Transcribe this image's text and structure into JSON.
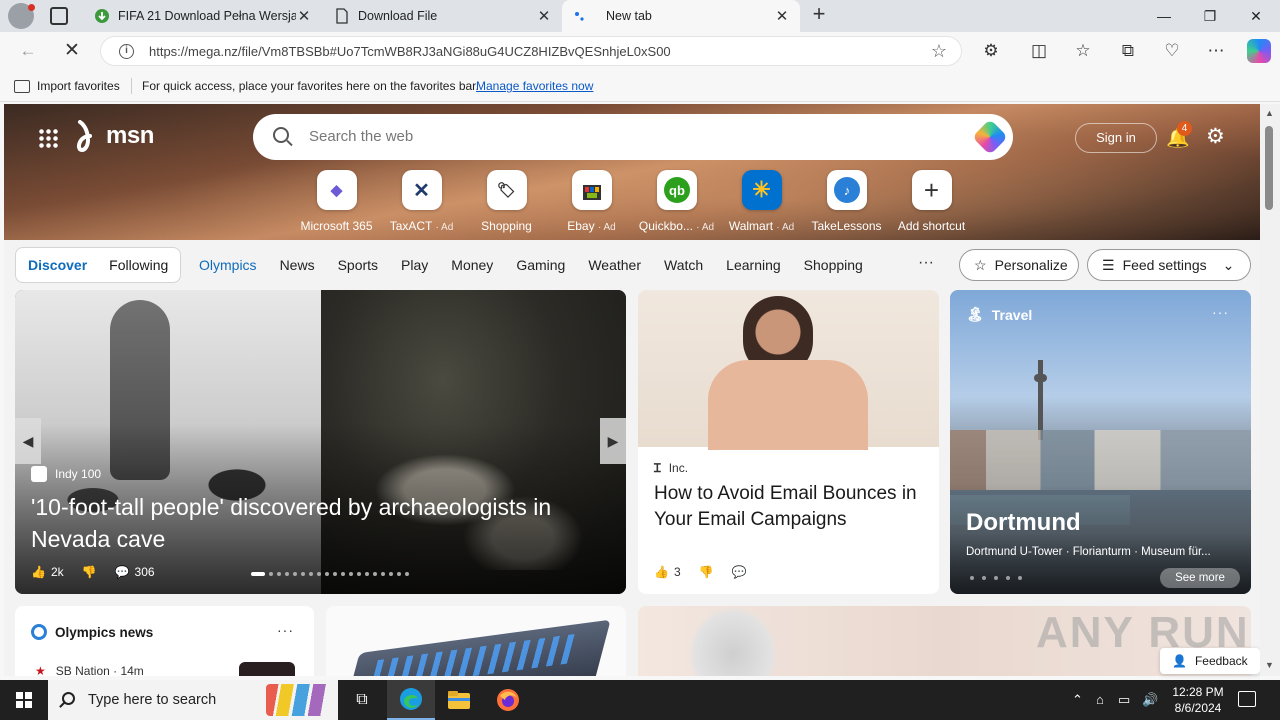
{
  "tabs": [
    {
      "title": "FIFA 21 Download Pełna Wersja z",
      "favicon": "download-green-icon"
    },
    {
      "title": "Download File",
      "favicon": "file-icon"
    },
    {
      "title": "New tab",
      "favicon": "loading-icon"
    }
  ],
  "address": {
    "url": "https://mega.nz/file/Vm8TBSBb#Uo7TcmWB8RJ3aNGi88uG4UCZ8HIZBvQESnhjeL0xS00"
  },
  "favorites_bar": {
    "import_label": "Import favorites",
    "message": "For quick access, place your favorites here on the favorites bar.",
    "manage_link": "Manage favorites now"
  },
  "msn": {
    "logo_text": "msn",
    "search_placeholder": "Search the web",
    "sign_in": "Sign in",
    "notification_count": "4",
    "shortcuts": [
      {
        "label": "Microsoft 365",
        "ad": "",
        "glyph": "◆",
        "color": "#6b5bd6"
      },
      {
        "label": "TaxACT",
        "ad": "· Ad",
        "glyph": "✕",
        "color": "#1f3b6e"
      },
      {
        "label": "Shopping",
        "ad": "",
        "glyph": "🏷",
        "color": "#333333"
      },
      {
        "label": "Ebay",
        "ad": "· Ad",
        "glyph": "🛍",
        "color": "#e53238"
      },
      {
        "label": "Quickbo...",
        "ad": "· Ad",
        "glyph": "qb",
        "color": "#2ca01c"
      },
      {
        "label": "Walmart",
        "ad": "· Ad",
        "glyph": "✳",
        "color": "#0071ce"
      },
      {
        "label": "TakeLessons",
        "ad": "",
        "glyph": "♪",
        "color": "#2a7fd6"
      },
      {
        "label": "Add shortcut",
        "ad": "",
        "glyph": "+",
        "color": "#333333"
      }
    ],
    "feed_tabs": {
      "discover": "Discover",
      "following": "Following"
    },
    "categories": [
      "Olympics",
      "News",
      "Sports",
      "Play",
      "Money",
      "Gaming",
      "Weather",
      "Watch",
      "Learning",
      "Shopping"
    ],
    "more": "···",
    "personalize": "Personalize",
    "feed_settings": "Feed settings"
  },
  "cards": {
    "main": {
      "source": "Indy 100",
      "headline": "'10-foot-tall people' discovered by archaeologists in Nevada cave",
      "likes": "2k",
      "comments": "306"
    },
    "mail": {
      "source": "Inc.",
      "headline": "How to Avoid Email Bounces in Your Email Campaigns",
      "likes": "3"
    },
    "travel": {
      "tag": "Travel",
      "title": "Dortmund",
      "subtitle": "Dortmund U-Tower · Florianturm · Museum für...",
      "see_more": "See more"
    },
    "olympics": {
      "title": "Olympics news",
      "source": "SB Nation · 14m"
    }
  },
  "feedback": "Feedback",
  "watermark": "ANY RUN",
  "taskbar": {
    "search_placeholder": "Type here to search",
    "time": "12:28 PM",
    "date": "8/6/2024"
  }
}
